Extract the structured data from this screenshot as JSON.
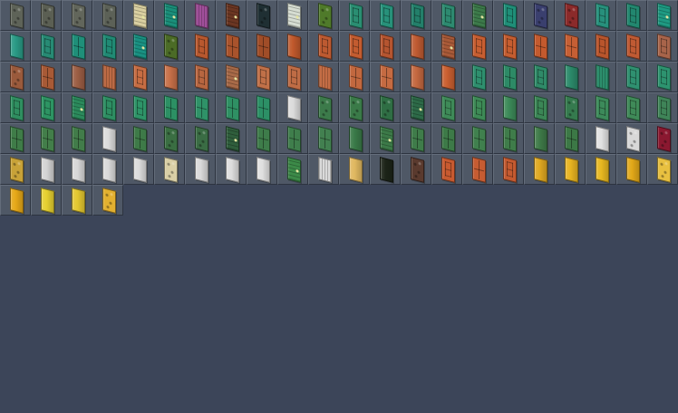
{
  "palette": {
    "background": "#3c4559",
    "cell": "#4f5866"
  },
  "tiles": [
    {
      "color": "#5e6358",
      "style": 6
    },
    {
      "color": "#5b5f53",
      "style": 6
    },
    {
      "color": "#62665b",
      "style": 6
    },
    {
      "color": "#5c6157",
      "style": 6
    },
    {
      "color": "#d9cfa0",
      "style": 4
    },
    {
      "color": "#1a8f7a",
      "style": 4
    },
    {
      "color": "#a04f9a",
      "style": 5
    },
    {
      "color": "#6b3622",
      "style": 4
    },
    {
      "color": "#1f2f33",
      "style": 6
    },
    {
      "color": "#d6ddd2",
      "style": 4
    },
    {
      "color": "#4f7a2a",
      "style": 6
    },
    {
      "color": "#2a8e72",
      "style": 2
    },
    {
      "color": "#27917a",
      "style": 2
    },
    {
      "color": "#237f6a",
      "style": 2
    },
    {
      "color": "#2d8a70",
      "style": 2
    },
    {
      "color": "#3c7a4a",
      "style": 4
    },
    {
      "color": "#1f8e78",
      "style": 2
    },
    {
      "color": "#3a3f6e",
      "style": 6
    },
    {
      "color": "#8b2a2a",
      "style": 6
    },
    {
      "color": "#27907c",
      "style": 2
    },
    {
      "color": "#22876f",
      "style": 2
    },
    {
      "color": "#1e9a82",
      "style": 4
    },
    {
      "color": "#2a9a85",
      "style": 1
    },
    {
      "color": "#278a74",
      "style": 2
    },
    {
      "color": "#1f8f79",
      "style": 3
    },
    {
      "color": "#208a74",
      "style": 2
    },
    {
      "color": "#199182",
      "style": 4
    },
    {
      "color": "#4b6b26",
      "style": 6
    },
    {
      "color": "#b8582e",
      "style": 2
    },
    {
      "color": "#a9532c",
      "style": 3
    },
    {
      "color": "#a04d28",
      "style": 3
    },
    {
      "color": "#c0592c",
      "style": 1
    },
    {
      "color": "#bd5a31",
      "style": 2
    },
    {
      "color": "#c35c30",
      "style": 2
    },
    {
      "color": "#b55530",
      "style": 2
    },
    {
      "color": "#bf5b32",
      "style": 1
    },
    {
      "color": "#a95a38",
      "style": 4
    },
    {
      "color": "#c75e31",
      "style": 2
    },
    {
      "color": "#c55d30",
      "style": 2
    },
    {
      "color": "#c45a2e",
      "style": 3
    },
    {
      "color": "#c65f34",
      "style": 3
    },
    {
      "color": "#b9552c",
      "style": 2
    },
    {
      "color": "#c05a33",
      "style": 2
    },
    {
      "color": "#a8644a",
      "style": 2
    },
    {
      "color": "#9a5a3c",
      "style": 6
    },
    {
      "color": "#a85a36",
      "style": 3
    },
    {
      "color": "#9c5e44",
      "style": 1
    },
    {
      "color": "#bd6a44",
      "style": 5
    },
    {
      "color": "#c76d43",
      "style": 2
    },
    {
      "color": "#c87048",
      "style": 1
    },
    {
      "color": "#b86640",
      "style": 2
    },
    {
      "color": "#a86a48",
      "style": 4
    },
    {
      "color": "#c07048",
      "style": 2
    },
    {
      "color": "#bf6c45",
      "style": 2
    },
    {
      "color": "#c46d45",
      "style": 5
    },
    {
      "color": "#c2683f",
      "style": 3
    },
    {
      "color": "#c56b42",
      "style": 3
    },
    {
      "color": "#c46840",
      "style": 1
    },
    {
      "color": "#ca5f30",
      "style": 1
    },
    {
      "color": "#2e8f6e",
      "style": 2
    },
    {
      "color": "#2d8a66",
      "style": 3
    },
    {
      "color": "#2f8a68",
      "style": 2
    },
    {
      "color": "#2b8a6a",
      "style": 1
    },
    {
      "color": "#2c8e6c",
      "style": 5
    },
    {
      "color": "#2f9070",
      "style": 2
    },
    {
      "color": "#2d936f",
      "style": 2
    },
    {
      "color": "#2f8e60",
      "style": 2
    },
    {
      "color": "#2d9463",
      "style": 2
    },
    {
      "color": "#2b8a5c",
      "style": 4
    },
    {
      "color": "#2d8e62",
      "style": 2
    },
    {
      "color": "#2e9468",
      "style": 2
    },
    {
      "color": "#2c9064",
      "style": 3
    },
    {
      "color": "#2f9268",
      "style": 3
    },
    {
      "color": "#2f9064",
      "style": 3
    },
    {
      "color": "#2c9066",
      "style": 3
    },
    {
      "color": "#dcdcdc",
      "style": 1
    },
    {
      "color": "#3c7a4a",
      "style": 6
    },
    {
      "color": "#3a7a48",
      "style": 6
    },
    {
      "color": "#2f6e44",
      "style": 6
    },
    {
      "color": "#2d6a48",
      "style": 4
    },
    {
      "color": "#3e8a58",
      "style": 2
    },
    {
      "color": "#3d8a56",
      "style": 2
    },
    {
      "color": "#3c8a58",
      "style": 1
    },
    {
      "color": "#3b8656",
      "style": 2
    },
    {
      "color": "#357a4e",
      "style": 6
    },
    {
      "color": "#3c8a5a",
      "style": 2
    },
    {
      "color": "#3f8a58",
      "style": 2
    },
    {
      "color": "#3f8458",
      "style": 2
    },
    {
      "color": "#3f7c48",
      "style": 3
    },
    {
      "color": "#437e4a",
      "style": 3
    },
    {
      "color": "#427c4a",
      "style": 3
    },
    {
      "color": "#dcdcdc",
      "style": 1
    },
    {
      "color": "#3e7a48",
      "style": 3
    },
    {
      "color": "#3a6e42",
      "style": 6
    },
    {
      "color": "#3a6c44",
      "style": 6
    },
    {
      "color": "#2f5e3c",
      "style": 4
    },
    {
      "color": "#3e7c4a",
      "style": 3
    },
    {
      "color": "#3f7e4c",
      "style": 3
    },
    {
      "color": "#428050",
      "style": 3
    },
    {
      "color": "#3a7a48",
      "style": 1
    },
    {
      "color": "#3c7a48",
      "style": 4
    },
    {
      "color": "#3f7c4a",
      "style": 3
    },
    {
      "color": "#3d7a48",
      "style": 3
    },
    {
      "color": "#40804e",
      "style": 3
    },
    {
      "color": "#3f7c4a",
      "style": 3
    },
    {
      "color": "#3e7a48",
      "style": 1
    },
    {
      "color": "#3c7846",
      "style": 3
    },
    {
      "color": "#e2e2e2",
      "style": 1
    },
    {
      "color": "#d8d8d8",
      "style": 6
    },
    {
      "color": "#8a1830",
      "style": 6
    },
    {
      "color": "#c8a238",
      "style": 6
    },
    {
      "color": "#d4d4d4",
      "style": 1
    },
    {
      "color": "#d8d8d8",
      "style": 1
    },
    {
      "color": "#dadada",
      "style": 1
    },
    {
      "color": "#dcdcdc",
      "style": 1
    },
    {
      "color": "#d9cfa6",
      "style": 6
    },
    {
      "color": "#dadada",
      "style": 1
    },
    {
      "color": "#dedede",
      "style": 1
    },
    {
      "color": "#e0e0e0",
      "style": 1
    },
    {
      "color": "#3c8a48",
      "style": 4
    },
    {
      "color": "#dadada",
      "style": 5
    },
    {
      "color": "#e0b860",
      "style": 1
    },
    {
      "color": "#1c2418",
      "style": 1
    },
    {
      "color": "#5a3a2e",
      "style": 6
    },
    {
      "color": "#c85a30",
      "style": 2
    },
    {
      "color": "#c65c32",
      "style": 3
    },
    {
      "color": "#c45a30",
      "style": 2
    },
    {
      "color": "#e0a820",
      "style": 1
    },
    {
      "color": "#e8b420",
      "style": 1
    },
    {
      "color": "#e8b820",
      "style": 1
    },
    {
      "color": "#e2a818",
      "style": 1
    },
    {
      "color": "#e8c040",
      "style": 6
    },
    {
      "color": "#e6a818",
      "style": 1
    },
    {
      "color": "#e6d030",
      "style": 1
    },
    {
      "color": "#e4c830",
      "style": 1
    },
    {
      "color": "#e2b030",
      "style": 6
    }
  ]
}
